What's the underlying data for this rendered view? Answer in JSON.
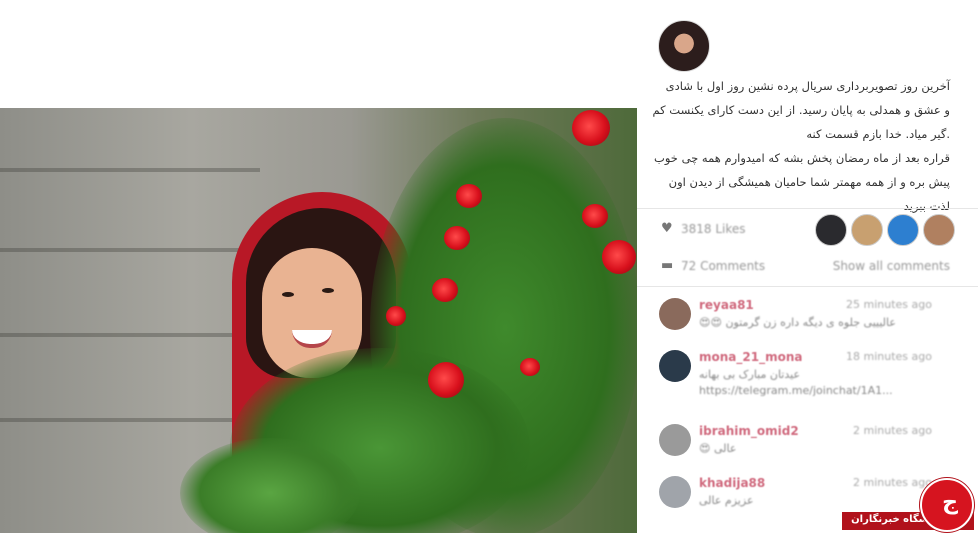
{
  "post": {
    "caption_lines": [
      "آخرین روز تصویربرداری سریال پرده نشین روز اول با شادی",
      "و عشق و همدلی به پایان رسید. از این دست کارای یکنست کم",
      ".گیر میاد. خدا بازم قسمت کنه",
      "قراره بعد از ماه رمضان پخش بشه که امیدوارم همه چی خوب",
      "پیش بره و از همه مهمتر شما حامیان همیشگی از دیدن اون",
      "لذت ببرید"
    ],
    "likes_text": "3818 Likes",
    "comments_text": "72 Comments",
    "show_all": "Show all comments"
  },
  "comments": [
    {
      "user": "reyaa81",
      "time": "25 minutes ago",
      "text": "😍😍 عالیییی جلوه ی دیگه داره زن گرمتون",
      "text2": ""
    },
    {
      "user": "mona_21_mona",
      "time": "18 minutes ago",
      "text": "عیدتان مبارک بی بهانه",
      "text2": "https://telegram.me/joinchat/1A1..."
    },
    {
      "user": "ibrahim_omid2",
      "time": "2 minutes ago",
      "text": "😍 عالی",
      "text2": ""
    },
    {
      "user": "khadija88",
      "time": "2 minutes ago",
      "text": "عزیزم عالی",
      "text2": ""
    }
  ],
  "watermark": {
    "text": "باشگاه خبرنگاران",
    "logo_glyph": "ج"
  },
  "colors": {
    "accent_red": "#b1121b",
    "username_pink": "#d06a7e"
  }
}
